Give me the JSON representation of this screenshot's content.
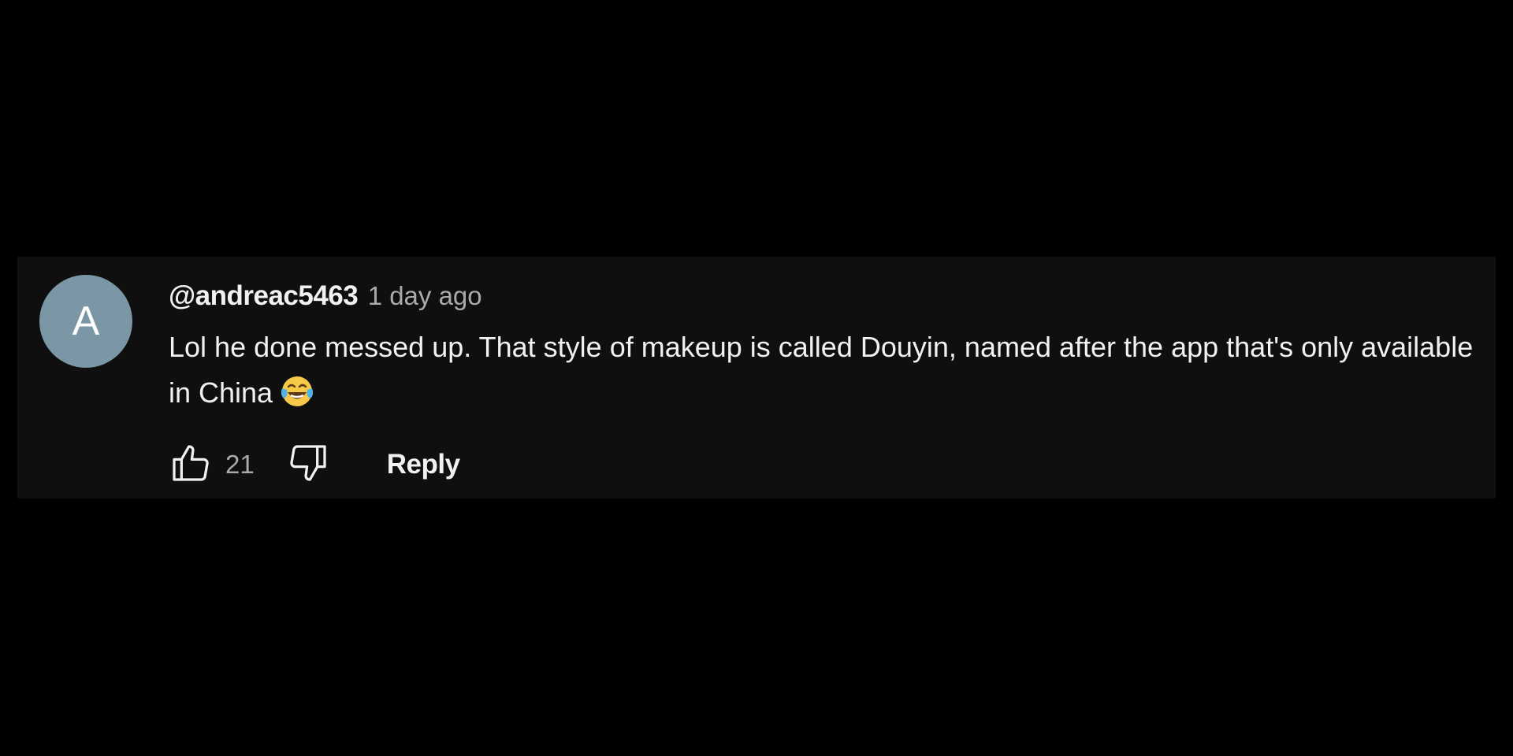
{
  "comment": {
    "avatar_letter": "A",
    "author": "@andreac5463",
    "timestamp": "1 day ago",
    "text": "Lol he done messed up.  That style of makeup is called Douyin, named after the app that's only available in China",
    "emoji": "face-with-tears-of-joy-icon",
    "like_count": "21",
    "reply_label": "Reply",
    "like_icon": "thumbs-up-icon",
    "dislike_icon": "thumbs-down-icon"
  },
  "colors": {
    "page_background": "#000000",
    "card_background": "#0f0f0f",
    "avatar_background": "#7b97a5",
    "primary_text": "#f1f1f1",
    "secondary_text": "#aaaaaa"
  }
}
